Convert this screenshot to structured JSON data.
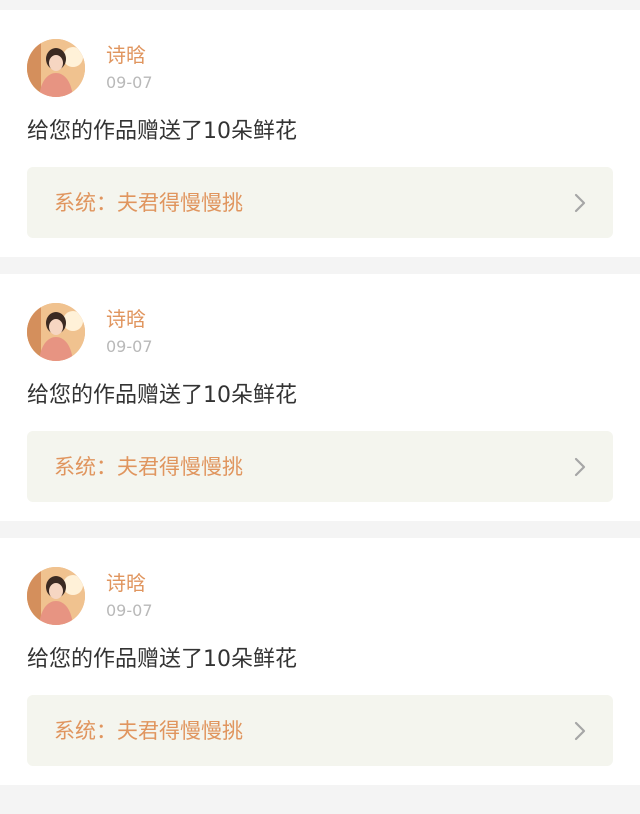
{
  "notifications": [
    {
      "username": "诗晗",
      "date": "09-07",
      "message": "给您的作品赠送了10朵鲜花",
      "work_title": "系统：夫君得慢慢挑"
    },
    {
      "username": "诗晗",
      "date": "09-07",
      "message": "给您的作品赠送了10朵鲜花",
      "work_title": "系统：夫君得慢慢挑"
    },
    {
      "username": "诗晗",
      "date": "09-07",
      "message": "给您的作品赠送了10朵鲜花",
      "work_title": "系统：夫君得慢慢挑"
    }
  ],
  "colors": {
    "accent": "#e0955e",
    "timestamp": "#b9b9b9",
    "text": "#333333",
    "link_background": "#f4f5ee",
    "page_background": "#f4f4f4"
  },
  "icons": {
    "avatar": "user-avatar",
    "link_arrow": "chevron-right-icon"
  }
}
